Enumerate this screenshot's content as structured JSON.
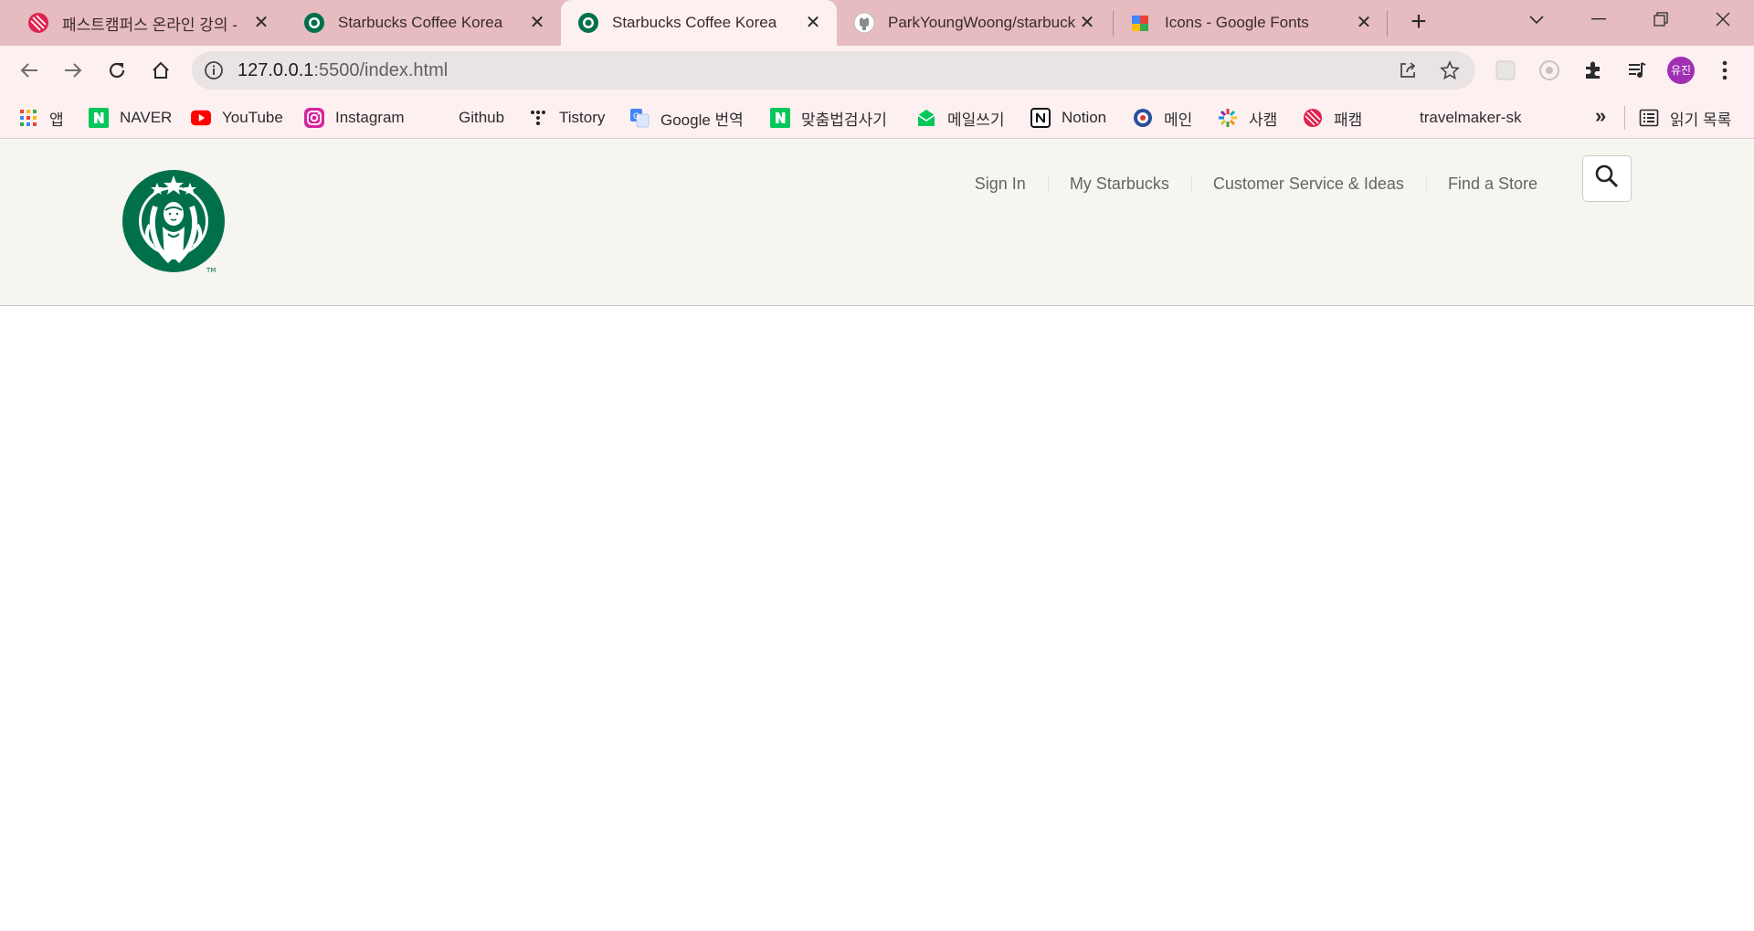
{
  "browser": {
    "tabs": [
      {
        "title": "패스트캠퍼스 온라인 강의 -",
        "favicon": "fastcampus-icon",
        "active": false
      },
      {
        "title": "Starbucks Coffee Korea",
        "favicon": "starbucks-icon",
        "active": false
      },
      {
        "title": "Starbucks Coffee Korea",
        "favicon": "starbucks-icon",
        "active": true
      },
      {
        "title": "ParkYoungWoong/starbuck",
        "favicon": "github-icon",
        "active": false
      },
      {
        "title": "Icons - Google Fonts",
        "favicon": "google-fonts-icon",
        "active": false
      }
    ],
    "url": {
      "host": "127.0.0.1",
      "path": ":5500/index.html"
    },
    "profile_label": "유진",
    "bookmarks": [
      {
        "label": "앱",
        "icon": "apps-grid-icon"
      },
      {
        "label": "NAVER",
        "icon": "naver-icon"
      },
      {
        "label": "YouTube",
        "icon": "youtube-icon"
      },
      {
        "label": "Instagram",
        "icon": "instagram-icon"
      },
      {
        "label": "Github",
        "icon": "github-icon"
      },
      {
        "label": "Tistory",
        "icon": "tistory-icon"
      },
      {
        "label": "Google 번역",
        "icon": "google-translate-icon"
      },
      {
        "label": "맞춤법검사기",
        "icon": "naver-icon"
      },
      {
        "label": "메일쓰기",
        "icon": "mail-icon"
      },
      {
        "label": "Notion",
        "icon": "notion-icon"
      },
      {
        "label": "메인",
        "icon": "globe-icon"
      },
      {
        "label": "사캠",
        "icon": "sunburst-icon"
      },
      {
        "label": "패캠",
        "icon": "fastcampus-icon"
      },
      {
        "label": "travelmaker-sk",
        "icon": "blank-icon"
      }
    ],
    "more_label": "»",
    "reading_list_label": "읽기 목록"
  },
  "site": {
    "logo": "starbucks-siren-logo",
    "sub_menu": [
      "Sign In",
      "My Starbucks",
      "Customer Service & Ideas",
      "Find a Store"
    ],
    "search_icon": "search-icon",
    "colors": {
      "header_bg": "#f6f5f0",
      "brand_green": "#00704a",
      "link": "#656565"
    }
  }
}
